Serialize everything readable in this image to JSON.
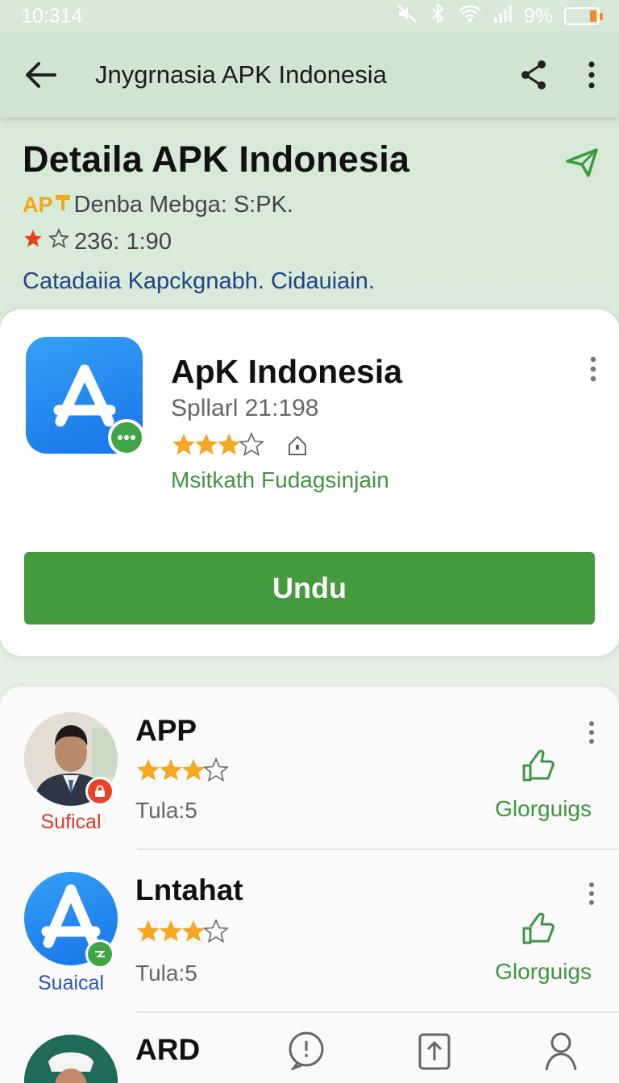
{
  "status_bar": {
    "time": "10:314",
    "battery": "9%"
  },
  "app_bar": {
    "title": "Jnygrnasia APK Indonesia"
  },
  "header": {
    "title": "Detaila APK Indonesia",
    "apk_tag": "AP",
    "subtitle": "Denba Mebga: S:PK.",
    "rating": "236: 1:90",
    "category": "Catadaiia Kapckgnabh. Cidauiain."
  },
  "app_card": {
    "name": "ApK Indonesia",
    "version": "Spllarl 21:198",
    "rating": 3.5,
    "developer": "Msitkath Fudagsinjain",
    "download_label": "Undu"
  },
  "list": {
    "items": [
      {
        "name": "APP",
        "rating": 3.5,
        "count": "Tula:5",
        "badge_label": "Sufical",
        "action_label": "Glorguigs"
      },
      {
        "name": "Lntahat",
        "rating": 3.5,
        "count": "Tula:5",
        "badge_label": "Suaical",
        "action_label": "Glorguigs"
      },
      {
        "name": "ARD"
      }
    ]
  },
  "colors": {
    "accent_green": "#45993e",
    "star": "#f5a623",
    "link_blue": "#23428a",
    "app_icon_blue": "#1774ea"
  }
}
